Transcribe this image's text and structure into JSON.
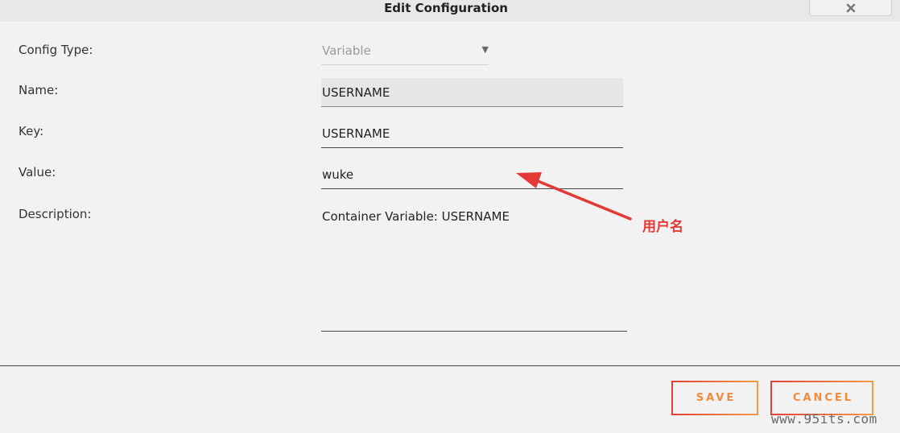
{
  "dialog": {
    "title": "Edit Configuration",
    "close_icon": "close-icon"
  },
  "form": {
    "config_type": {
      "label": "Config Type:",
      "value": "Variable"
    },
    "name": {
      "label": "Name:",
      "value": "USERNAME"
    },
    "key": {
      "label": "Key:",
      "value": "USERNAME"
    },
    "value": {
      "label": "Value:",
      "value": "wuke"
    },
    "description": {
      "label": "Description:",
      "value": "Container Variable: USERNAME"
    }
  },
  "actions": {
    "save_label": "SAVE",
    "cancel_label": "CANCEL"
  },
  "annotation": {
    "text": "用户名",
    "color": "#e53935"
  },
  "watermark": "www.95its.com",
  "colors": {
    "background": "#f2f2f2",
    "button_gradient_start": "#e2403a",
    "button_gradient_end": "#f39a45"
  }
}
